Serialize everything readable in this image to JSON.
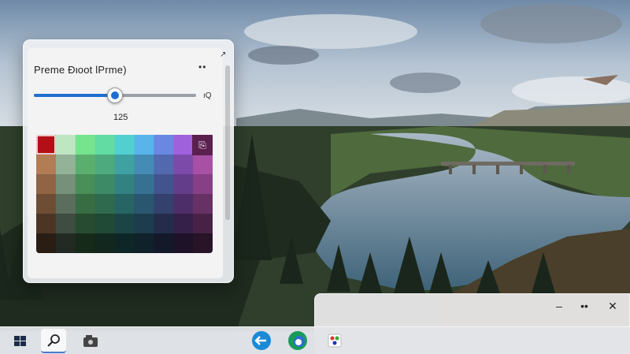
{
  "picker": {
    "title": "Preme Đιoot lPrme)",
    "more_label": "••",
    "slider_value": "125",
    "slider_end_label": "ıQ",
    "slider_fraction": 0.5,
    "corner_icon": "copy-icon"
  },
  "swatches": {
    "selected_color": "#b30f17",
    "columns": [
      "#c31a1d",
      "#bfe6c3",
      "#76e38e",
      "#62dca3",
      "#52d0d0",
      "#58b4ea",
      "#6a87e2",
      "#a061dc",
      "#d867d4"
    ]
  },
  "window2": {
    "minimize_label": "–",
    "more_label": "••",
    "close_label": "✕"
  },
  "taskbar": {
    "items": [
      {
        "name": "start-button",
        "icon": "windows-icon"
      },
      {
        "name": "search-button",
        "icon": "search-icon",
        "active": true
      },
      {
        "name": "task-view-button",
        "icon": "camera-icon"
      },
      {
        "name": "app-1",
        "icon": "arrow-app-icon"
      },
      {
        "name": "app-2",
        "icon": "edge-icon"
      },
      {
        "name": "app-3",
        "icon": "paint-icon"
      }
    ]
  }
}
